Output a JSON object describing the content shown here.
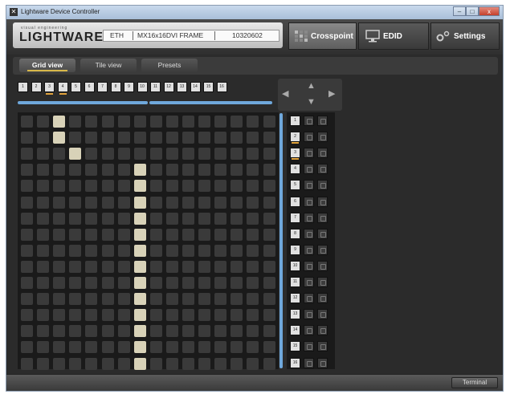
{
  "window": {
    "title": "Lightware Device Controller",
    "minimize": "–",
    "maximize": "□",
    "close": "x"
  },
  "header": {
    "logo_tagline": "visual engineering",
    "logo_text": "LIGHTWARE",
    "connection": "ETH",
    "device_name": "MX16x16DVI FRAME",
    "serial": "10320602",
    "tabs": [
      {
        "label": "Crosspoint",
        "icon": "grid-icon",
        "active": true
      },
      {
        "label": "EDID",
        "icon": "monitor-icon",
        "active": false
      },
      {
        "label": "Settings",
        "icon": "gears-icon",
        "active": false
      }
    ]
  },
  "subtabs": [
    {
      "label": "Grid view",
      "active": true
    },
    {
      "label": "Tile view",
      "active": false
    },
    {
      "label": "Presets",
      "active": false
    }
  ],
  "inputs": [
    "1",
    "2",
    "3",
    "4",
    "5",
    "6",
    "7",
    "8",
    "9",
    "10",
    "11",
    "12",
    "13",
    "14",
    "15",
    "16"
  ],
  "marked_inputs": [
    "3",
    "4"
  ],
  "outputs": [
    "1",
    "2",
    "3",
    "4",
    "5",
    "6",
    "7",
    "8",
    "9",
    "10",
    "11",
    "12",
    "13",
    "14",
    "15",
    "16"
  ],
  "marked_outputs": [
    "2",
    "3"
  ],
  "connections": [
    {
      "input": 3,
      "output": 1
    },
    {
      "input": 3,
      "output": 2
    },
    {
      "input": 4,
      "output": 3
    },
    {
      "input": 8,
      "output": 4
    },
    {
      "input": 8,
      "output": 5
    },
    {
      "input": 8,
      "output": 6
    },
    {
      "input": 8,
      "output": 7
    },
    {
      "input": 8,
      "output": 8
    },
    {
      "input": 8,
      "output": 9
    },
    {
      "input": 8,
      "output": 10
    },
    {
      "input": 8,
      "output": 11
    },
    {
      "input": 8,
      "output": 12
    },
    {
      "input": 8,
      "output": 13
    },
    {
      "input": 8,
      "output": 14
    },
    {
      "input": 8,
      "output": 15
    },
    {
      "input": 8,
      "output": 16
    }
  ],
  "arrows": {
    "left": "◀",
    "right": "▶",
    "up": "▲",
    "down": "▼"
  },
  "statusbar": {
    "terminal_label": "Terminal"
  },
  "colors": {
    "highlight_bar": "#6fa8dc",
    "selected_mark": "#e0a23c",
    "connected_cell": "#d8d2b8"
  }
}
